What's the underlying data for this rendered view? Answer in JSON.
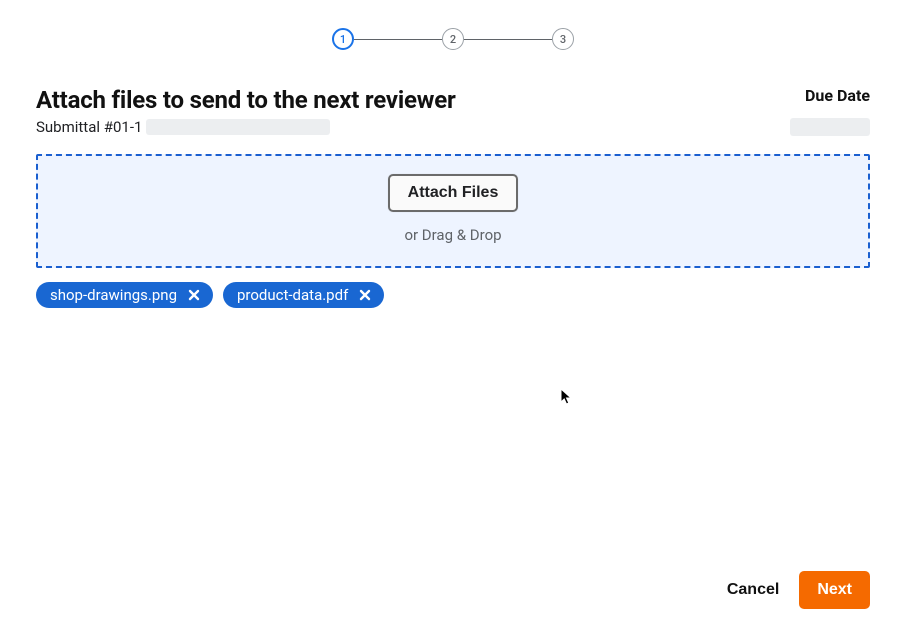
{
  "stepper": {
    "steps": [
      {
        "label": "1",
        "active": true
      },
      {
        "label": "2",
        "active": false
      },
      {
        "label": "3",
        "active": false
      }
    ]
  },
  "header": {
    "title": "Attach files to send to the next reviewer",
    "due_date_label": "Due Date",
    "submittal_prefix": "Submittal #01-1"
  },
  "dropzone": {
    "button_label": "Attach Files",
    "hint": "or Drag & Drop"
  },
  "attachments": [
    {
      "name": "shop-drawings.png"
    },
    {
      "name": "product-data.pdf"
    }
  ],
  "footer": {
    "cancel": "Cancel",
    "next": "Next"
  }
}
